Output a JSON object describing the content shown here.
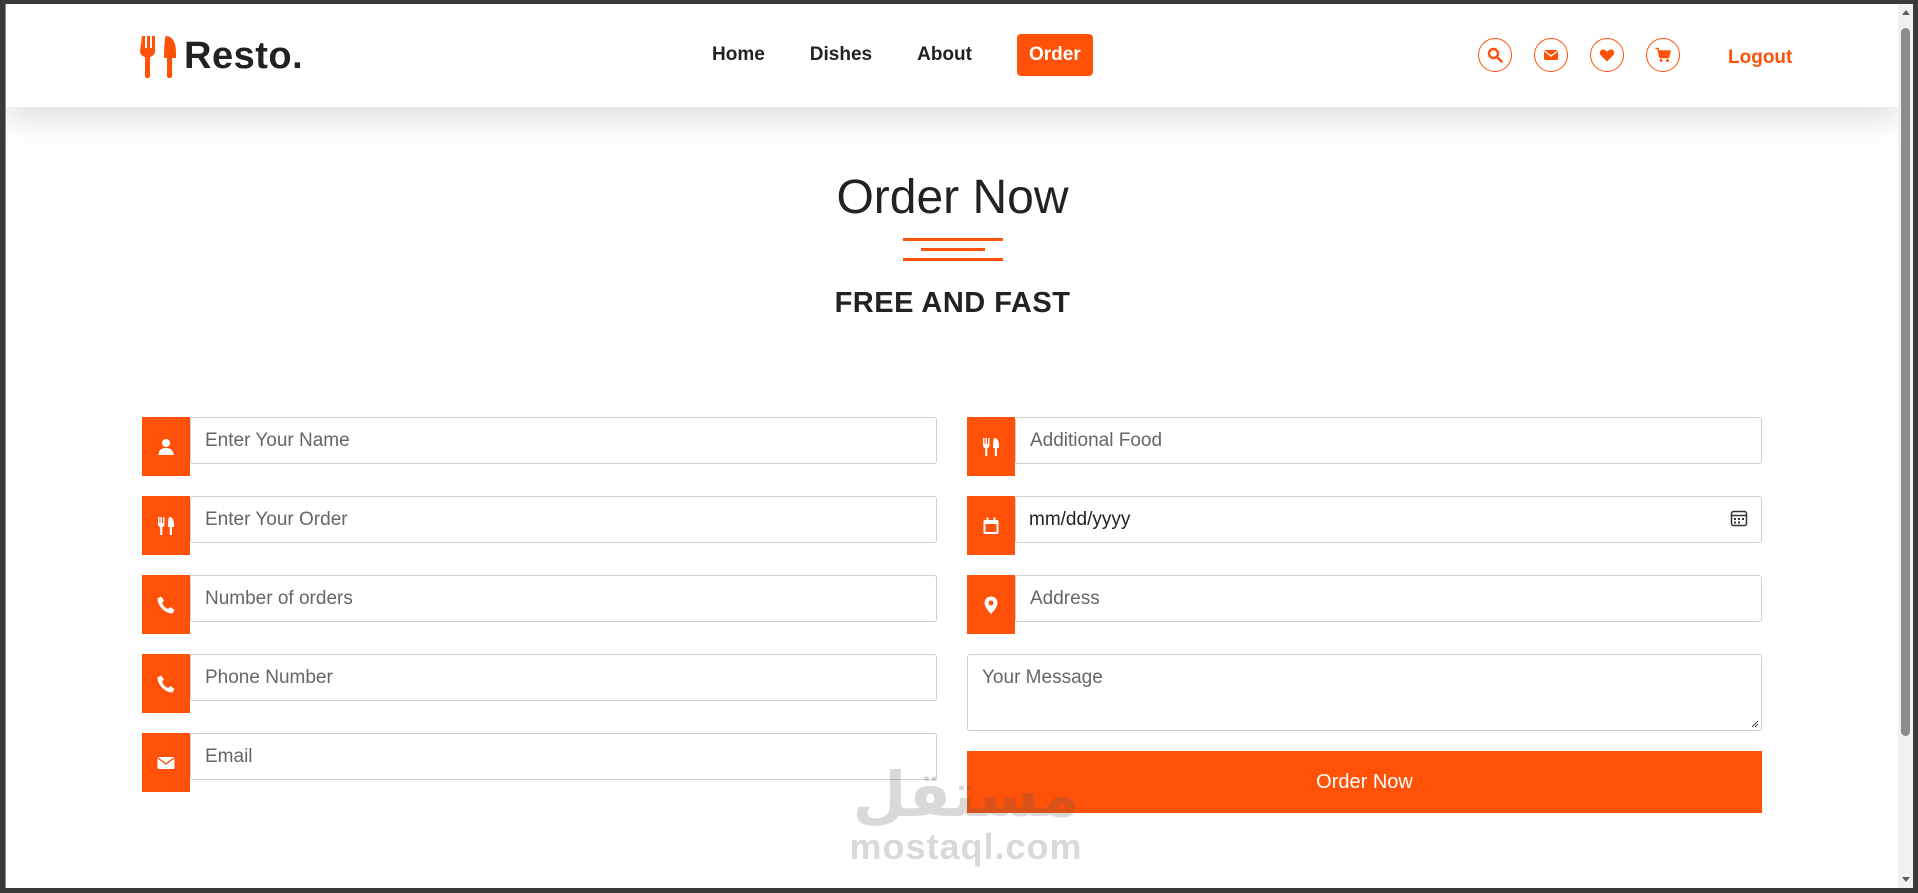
{
  "brand": {
    "name": "Resto.",
    "accent_color": "#ff5208"
  },
  "nav": {
    "items": [
      {
        "label": "Home"
      },
      {
        "label": "Dishes"
      },
      {
        "label": "About"
      },
      {
        "label": "Order",
        "active": true
      }
    ]
  },
  "header_icons": [
    "search-icon",
    "envelope-icon",
    "heart-icon",
    "cart-icon"
  ],
  "logout_label": "Logout",
  "section": {
    "title": "Order Now",
    "subtitle": "FREE AND FAST"
  },
  "form": {
    "left": [
      {
        "icon": "user-icon",
        "placeholder": "Enter Your Name"
      },
      {
        "icon": "utensils-icon",
        "placeholder": "Enter Your Order"
      },
      {
        "icon": "phone-icon",
        "placeholder": "Number of orders"
      },
      {
        "icon": "phone-icon",
        "placeholder": "Phone Number"
      },
      {
        "icon": "envelope-icon",
        "placeholder": "Email"
      }
    ],
    "right": {
      "additional_food": {
        "icon": "utensils-icon",
        "placeholder": "Additional Food"
      },
      "date": {
        "icon": "calendar-icon",
        "value": "mm/dd/yyyy"
      },
      "address": {
        "icon": "location-pin-icon",
        "placeholder": "Address"
      },
      "message": {
        "placeholder": "Your Message"
      }
    },
    "submit_label": "Order Now"
  },
  "watermark": {
    "arabic": "مستقل",
    "latin": "mostaql.com"
  }
}
